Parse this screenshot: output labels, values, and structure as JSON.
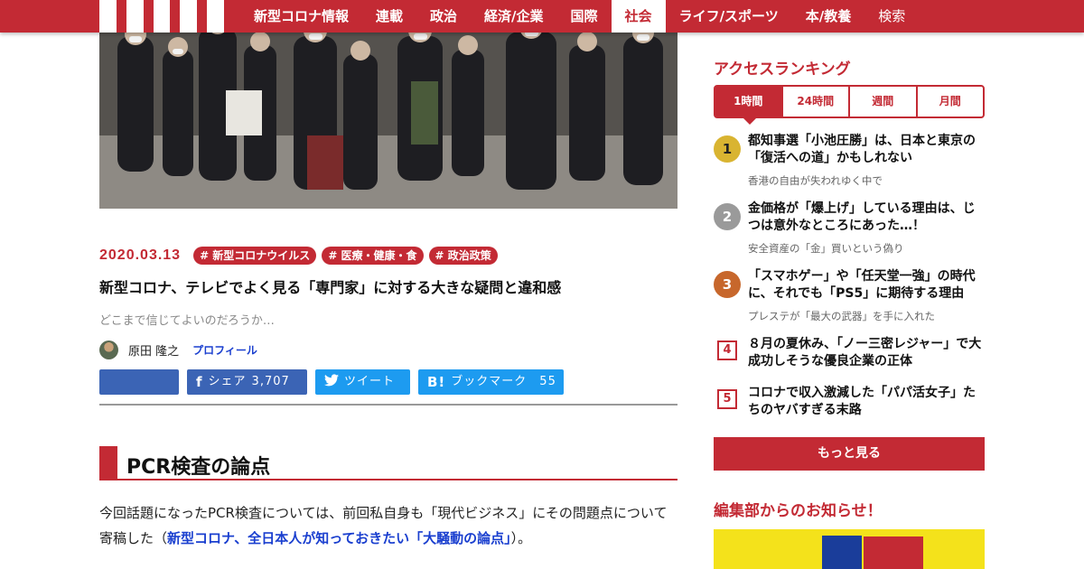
{
  "header": {
    "nav": [
      {
        "label": "新型コロナ情報",
        "active": false
      },
      {
        "label": "連載",
        "active": false
      },
      {
        "label": "政治",
        "active": false
      },
      {
        "label": "経済/企業",
        "active": false
      },
      {
        "label": "国際",
        "active": false
      },
      {
        "label": "社会",
        "active": true
      },
      {
        "label": "ライフ/スポーツ",
        "active": false
      },
      {
        "label": "本/教養",
        "active": false
      },
      {
        "label": "検索",
        "active": false
      }
    ]
  },
  "article": {
    "date": "2020.03.13",
    "tags": [
      "# 新型コロナウイルス",
      "# 医療・健康・食",
      "# 政治政策"
    ],
    "title": "新型コロナ、テレビでよく見る「専門家」に対する大きな疑問と違和感",
    "subtitle": "どこまで信じてよいのだろうか…",
    "author": "原田 隆之",
    "profile_label": "プロフィール",
    "share": {
      "facebook_label": "シェア",
      "facebook_count": "3,707",
      "twitter_label": "ツイート",
      "hatena_label": "ブックマーク",
      "hatena_count": "55"
    },
    "section_heading": "PCR検査の論点",
    "body_before": "今回話題になったPCR検査については、前回私自身も「現代ビジネス」にその問題点について寄稿した（",
    "body_link": "新型コロナ、全日本人が知っておきたい「大騒動の論点」",
    "body_after": "）。"
  },
  "sidebar": {
    "ranking_title": "アクセスランキング",
    "tabs": [
      "1時間",
      "24時間",
      "週間",
      "月間"
    ],
    "items": [
      {
        "rank": "1",
        "title": "都知事選「小池圧勝」は、日本と東京の「復活への道」かもしれない",
        "sub": "香港の自由が失われゆく中で"
      },
      {
        "rank": "2",
        "title": "金価格が「爆上げ」している理由は、じつは意外なところにあった…！",
        "sub": "安全資産の「金」買いという偽り"
      },
      {
        "rank": "3",
        "title": "「スマホゲー」や「任天堂一強」の時代に、それでも「PS5」に期待する理由",
        "sub": "プレステが「最大の武器」を手に入れた"
      },
      {
        "rank": "4",
        "title": "８月の夏休み、「ノー三密レジャー」で大成功しそうな優良企業の正体",
        "sub": ""
      },
      {
        "rank": "5",
        "title": "コロナで収入激減した「パパ活女子」たちのヤバすぎる末路",
        "sub": ""
      }
    ],
    "more_label": "もっと見る",
    "notice_title": "編集部からのお知らせ！"
  }
}
